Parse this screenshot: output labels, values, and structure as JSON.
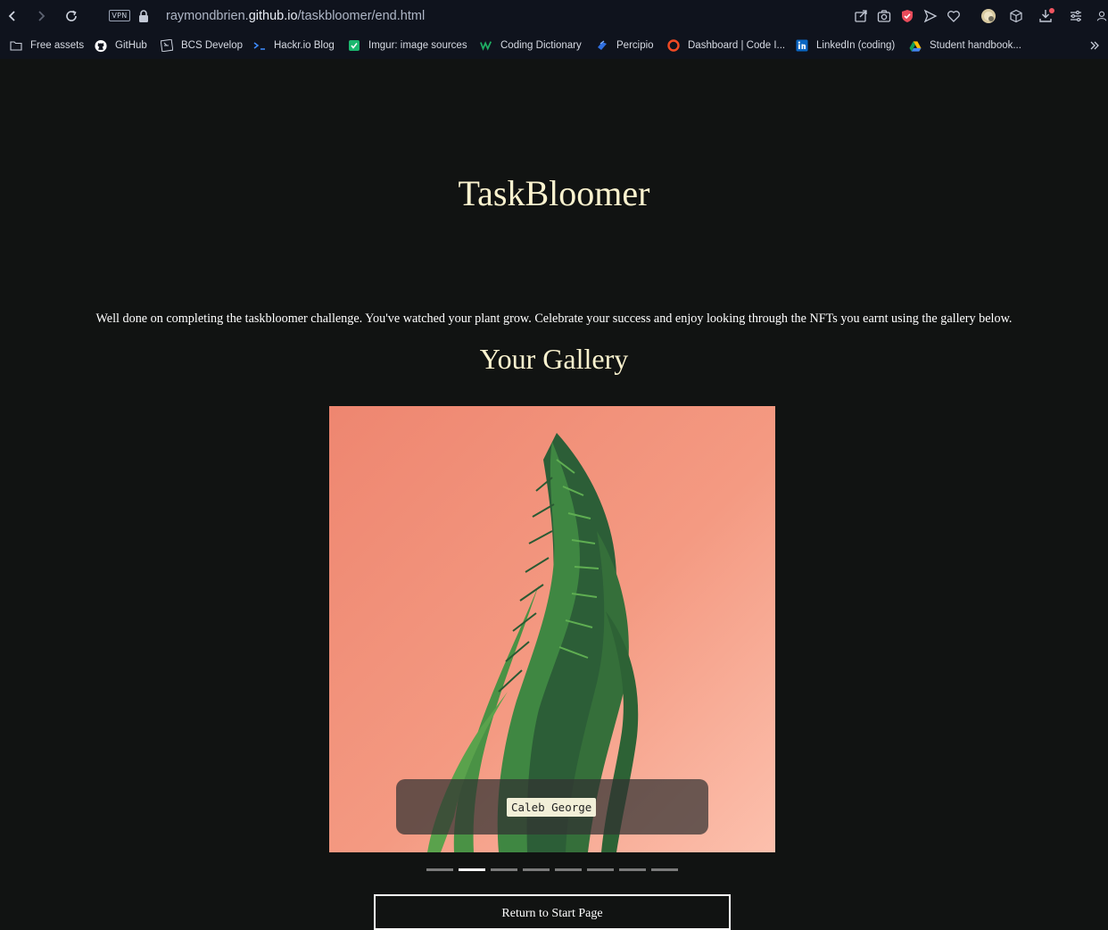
{
  "browser": {
    "vpn_label": "VPN",
    "url_prefix": "raymondbrien.",
    "url_host": "github.io",
    "url_path": "/taskbloomer/end.html"
  },
  "bookmarks": [
    {
      "label": "Free assets",
      "icon": "folder-icon"
    },
    {
      "label": "GitHub",
      "icon": "github-icon"
    },
    {
      "label": "BCS Develop",
      "icon": "bcs-icon"
    },
    {
      "label": "Hackr.io Blog",
      "icon": "hackr-icon"
    },
    {
      "label": "Imgur: image sources",
      "icon": "imgur-icon"
    },
    {
      "label": "Coding Dictionary",
      "icon": "coding-dictionary-icon"
    },
    {
      "label": "Percipio",
      "icon": "percipio-icon"
    },
    {
      "label": "Dashboard | Code I...",
      "icon": "code-institute-icon"
    },
    {
      "label": "LinkedIn (coding)",
      "icon": "linkedin-icon"
    },
    {
      "label": "Student handbook...",
      "icon": "google-drive-icon"
    }
  ],
  "page": {
    "title": "TaskBloomer",
    "intro": "Well done on completing the taskbloomer challenge. You've watched your plant grow. Celebrate your success and enjoy looking through the NFTs you earnt using the gallery below.",
    "gallery_title": "Your Gallery",
    "caption": "Caleb George",
    "return_button": "Return to Start Page"
  },
  "carousel": {
    "slide_count": 8,
    "active_index": 1
  },
  "colors": {
    "background": "#111312",
    "heading": "#fbf3cf",
    "slide_background": "#f59a82",
    "caption_background": "#f2efd8"
  }
}
